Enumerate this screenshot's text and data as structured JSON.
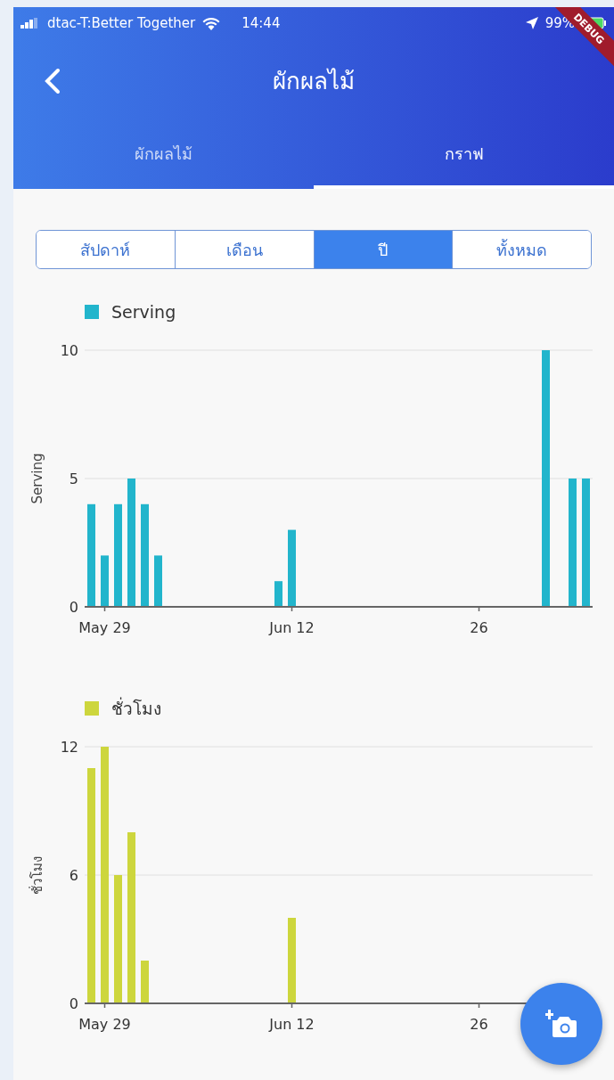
{
  "status_bar": {
    "carrier": "dtac-T:Better Together",
    "time": "14:44",
    "battery": "99%"
  },
  "debug_banner": "DEBUG",
  "app_bar": {
    "title": "ผักผลไม้"
  },
  "tabs": [
    {
      "label": "ผักผลไม้",
      "selected": false
    },
    {
      "label": "กราฟ",
      "selected": true
    }
  ],
  "range_selector": [
    {
      "label": "สัปดาห์",
      "selected": false
    },
    {
      "label": "เดือน",
      "selected": false
    },
    {
      "label": "ปี",
      "selected": true
    },
    {
      "label": "ทั้งหมด",
      "selected": false
    }
  ],
  "charts": [
    {
      "chart_data": {
        "type": "bar",
        "ylabel": "Serving",
        "categories": [
          null,
          "May 29",
          null,
          null,
          null,
          null,
          null,
          null,
          null,
          null,
          null,
          null,
          null,
          null,
          null,
          "Jun 12",
          null,
          null,
          null,
          null,
          null,
          null,
          null,
          null,
          null,
          null,
          null,
          null,
          null,
          "26",
          null,
          null,
          null,
          null,
          null,
          null,
          null,
          null
        ],
        "series": [
          {
            "name": "Serving",
            "color": "#22b5cc",
            "values": [
              4,
              2,
              4,
              5,
              4,
              2,
              null,
              null,
              null,
              null,
              null,
              null,
              null,
              null,
              1,
              3,
              null,
              null,
              null,
              null,
              null,
              null,
              null,
              null,
              null,
              null,
              null,
              null,
              null,
              null,
              null,
              null,
              null,
              null,
              10,
              null,
              5,
              5
            ]
          }
        ],
        "ylim": [
          0,
          10
        ],
        "yticks": [
          0,
          5,
          10
        ]
      }
    },
    {
      "chart_data": {
        "type": "bar",
        "ylabel": "ชั่วโมง",
        "categories": [
          null,
          "May 29",
          null,
          null,
          null,
          null,
          null,
          null,
          null,
          null,
          null,
          null,
          null,
          null,
          null,
          "Jun 12",
          null,
          null,
          null,
          null,
          null,
          null,
          null,
          null,
          null,
          null,
          null,
          null,
          null,
          "26",
          null,
          null,
          null,
          null,
          null,
          null,
          null,
          null
        ],
        "series": [
          {
            "name": "ชั่วโมง",
            "color": "#cdd63d",
            "values": [
              11,
              12,
              6,
              8,
              2,
              null,
              null,
              null,
              null,
              null,
              null,
              null,
              null,
              null,
              null,
              4,
              null,
              null,
              null,
              null,
              null,
              null,
              null,
              null,
              null,
              null,
              null,
              null,
              null,
              null,
              null,
              null,
              null,
              null,
              null,
              null,
              null,
              null
            ]
          }
        ],
        "ylim": [
          0,
          12
        ],
        "yticks": [
          0,
          6,
          12
        ]
      }
    }
  ]
}
